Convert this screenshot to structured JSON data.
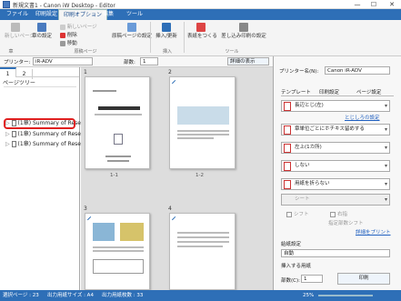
{
  "window": {
    "title": "新規文書1 - Canon iW Desktop - Editor",
    "minimize": "—",
    "maximize": "☐",
    "close": "✕"
  },
  "menu": {
    "items": [
      "ファイル",
      "印刷設定",
      "印刷オプション",
      "編集",
      "ツール"
    ],
    "active_index": 2
  },
  "ribbon": {
    "new_page": "新しいページ",
    "chapter_settings": "章の設定",
    "new_page_small": "新しいページ",
    "delete": "削除",
    "move": "移動",
    "page_group_label": "原稿ページ",
    "chapter_label": "章",
    "chapter_page_settings": "原稿ページの設定",
    "insert_update": "挿入/更新",
    "insert_label": "挿入",
    "combine_pages": "表紙をつくる",
    "combined_print": "差し込み印刷の設定",
    "tools_label": "ツール"
  },
  "printer_bar": {
    "label": "プリンター:",
    "printer": "iR-ADV",
    "page_label": "部数:",
    "pages": "1",
    "preview_label": "詳細の表示"
  },
  "left_pane": {
    "tabs": [
      "1",
      "2"
    ],
    "header": "ページツリー",
    "items": [
      "(1章) Summary of Research",
      "(1章) Summary of Rese",
      "(1章) Summary of Rese"
    ]
  },
  "pages": [
    {
      "num": "1",
      "label": "1-1"
    },
    {
      "num": "2",
      "label": "1-2"
    },
    {
      "num": "3",
      "label": ""
    },
    {
      "num": "4",
      "label": ""
    }
  ],
  "right_pane": {
    "printer_name_label": "プリンター名(N):",
    "printer_name": "Canon iR-ADV",
    "tabs": [
      "テンプレート",
      "印刷設定",
      "ページ設定"
    ],
    "paper_size": "長辺とじ(左)",
    "detail_link": "とじしろの設定",
    "duplex": "章単位ごとにホチキス留めする",
    "orientation": "左上(1カ所)",
    "staple": "しない",
    "fold": "用紙を折らない",
    "sheet": "シート",
    "shift_label": "シフト",
    "right_label": "右指",
    "repeat_label": "指定部数シフト",
    "detail_link2": "詳細をプリント",
    "paper_source_label": "給紙設定",
    "paper_source": "自動",
    "insert_paper_label": "挿入する用紙",
    "copies_label": "部数(C):",
    "copies": "1",
    "print_button": "印刷"
  },
  "status": {
    "selected": "選択ページ : 23",
    "paper_size": "出力用紙サイズ : A4",
    "output_count": "出力用紙枚数 : 33",
    "zoom": "25%"
  }
}
